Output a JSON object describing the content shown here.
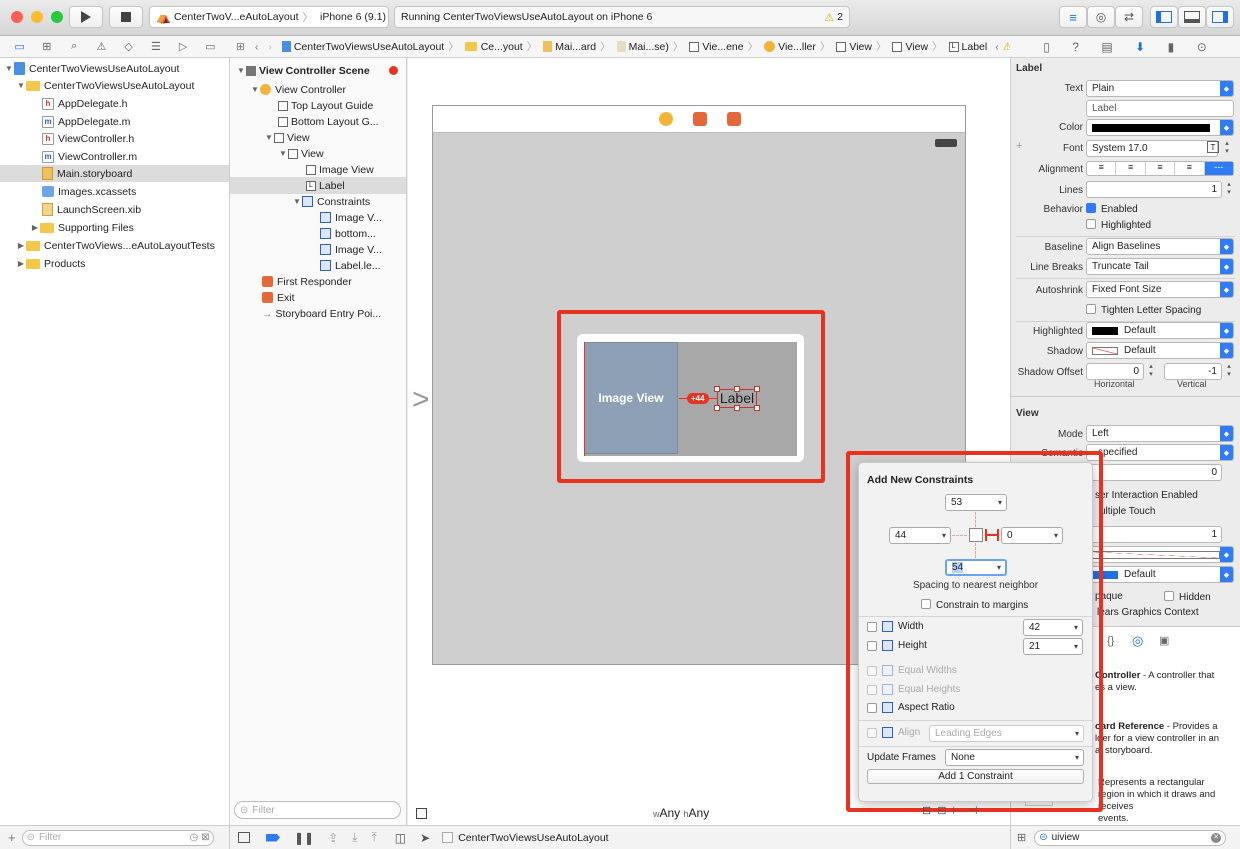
{
  "toolbar": {
    "scheme": "CenterTwoV...eAutoLayout",
    "device": "iPhone 6 (9.1)",
    "status": "Running CenterTwoViewsUseAutoLayout on iPhone 6",
    "warnings": "2"
  },
  "jumpbar": {
    "items": [
      "CenterTwoViewsUseAutoLayout",
      "Ce...yout",
      "Mai...ard",
      "Mai...se)",
      "Vie...ene",
      "Vie...ller",
      "View",
      "View",
      "Label"
    ]
  },
  "navigator": {
    "items": [
      {
        "label": "CenterTwoViewsUseAutoLayout"
      },
      {
        "label": "CenterTwoViewsUseAutoLayout"
      },
      {
        "label": "AppDelegate.h",
        "badge": "h"
      },
      {
        "label": "AppDelegate.m",
        "badge": "m"
      },
      {
        "label": "ViewController.h",
        "badge": "h"
      },
      {
        "label": "ViewController.m",
        "badge": "m"
      },
      {
        "label": "Main.storyboard"
      },
      {
        "label": "Images.xcassets"
      },
      {
        "label": "LaunchScreen.xib"
      },
      {
        "label": "Supporting Files"
      },
      {
        "label": "CenterTwoViews...eAutoLayoutTests"
      },
      {
        "label": "Products"
      }
    ],
    "filter_placeholder": "Filter"
  },
  "outline": {
    "items": [
      {
        "label": "View Controller Scene",
        "badge": "L"
      },
      {
        "label": "View Controller",
        "badge": "L"
      },
      {
        "label": "Top Layout Guide",
        "badge": "L"
      },
      {
        "label": "Bottom Layout G...",
        "badge": "L"
      },
      {
        "label": "View",
        "badge": "L"
      },
      {
        "label": "View",
        "badge": "L"
      },
      {
        "label": "Image View",
        "badge": "L"
      },
      {
        "label": "Label",
        "badge": "L"
      },
      {
        "label": "Constraints",
        "badge": "L"
      },
      {
        "label": "Image V...",
        "badge": "L"
      },
      {
        "label": "bottom...",
        "badge": "L"
      },
      {
        "label": "Image V...",
        "badge": "L"
      },
      {
        "label": "Label.le...",
        "badge": "L"
      },
      {
        "label": "First Responder",
        "badge": "L"
      },
      {
        "label": "Exit",
        "badge": "L"
      },
      {
        "label": "Storyboard Entry Poi...",
        "badge": "L"
      }
    ],
    "filter_placeholder": "Filter"
  },
  "canvas": {
    "image_view_label": "Image View",
    "label_text": "Label",
    "constraint_badge": "+44",
    "size_class_w": "Any",
    "size_class_h": "Any",
    "size_class_w_prefix": "w",
    "size_class_h_prefix": "h"
  },
  "popover": {
    "title": "Add New Constraints",
    "top": "53",
    "left": "44",
    "right": "0",
    "bottom": "54",
    "spacing_label": "Spacing to nearest neighbor",
    "margins_label": "Constrain to margins",
    "width_label": "Width",
    "width_value": "42",
    "height_label": "Height",
    "height_value": "21",
    "equal_widths": "Equal Widths",
    "equal_heights": "Equal Heights",
    "aspect_ratio": "Aspect Ratio",
    "align_label": "Align",
    "align_value": "Leading Edges",
    "update_frames_label": "Update Frames",
    "update_frames_value": "None",
    "add_button": "Add 1 Constraint"
  },
  "inspector": {
    "section_label": "Label",
    "text_label": "Text",
    "text_value": "Plain",
    "text_content": "Label",
    "color_label": "Color",
    "font_label": "Font",
    "font_value": "System 17.0",
    "alignment_label": "Alignment",
    "lines_label": "Lines",
    "lines_value": "1",
    "behavior_label": "Behavior",
    "enabled_label": "Enabled",
    "highlighted_cb_label": "Highlighted",
    "baseline_label": "Baseline",
    "baseline_value": "Align Baselines",
    "linebreaks_label": "Line Breaks",
    "linebreaks_value": "Truncate Tail",
    "autoshrink_label": "Autoshrink",
    "autoshrink_value": "Fixed Font Size",
    "tighten_label": "Tighten Letter Spacing",
    "highlighted_label": "Highlighted",
    "highlighted_value": "Default",
    "shadow_label": "Shadow",
    "shadow_value": "Default",
    "shadow_offset_label": "Shadow Offset",
    "shadow_h": "0",
    "shadow_v": "-1",
    "horizontal": "Horizontal",
    "vertical": "Vertical",
    "view_section": "View",
    "mode_label": "Mode",
    "mode_value": "Left",
    "semantic_partial": "Semantic",
    "semantic_value": "specified",
    "tag_value": "0",
    "user_interaction": "ser Interaction Enabled",
    "multiple_touch": "ultiple Touch",
    "alpha_value": "1",
    "tint_value": "Default",
    "opaque": "paque",
    "hidden": "Hidden",
    "clears": "lears Graphics Context",
    "lib1_title": "Controller",
    "lib1_desc": " - A controller that",
    "lib1_desc2": "es a view.",
    "lib2_title": "oard Reference",
    "lib2_desc": " - Provides a",
    "lib2_desc2": "lder for a view controller in an",
    "lib2_desc3": "al storyboard.",
    "lib3_desc": "Represents a rectangular",
    "lib3_desc2": "region in which it draws and receives",
    "lib3_desc3": "events.",
    "search_value": "uiview"
  },
  "debugbar": {
    "target": "CenterTwoViewsUseAutoLayout"
  },
  "colors": {
    "accent": "#2f7cf6",
    "highlight_red": "#e8321f",
    "image_view": "#8da0b6"
  }
}
